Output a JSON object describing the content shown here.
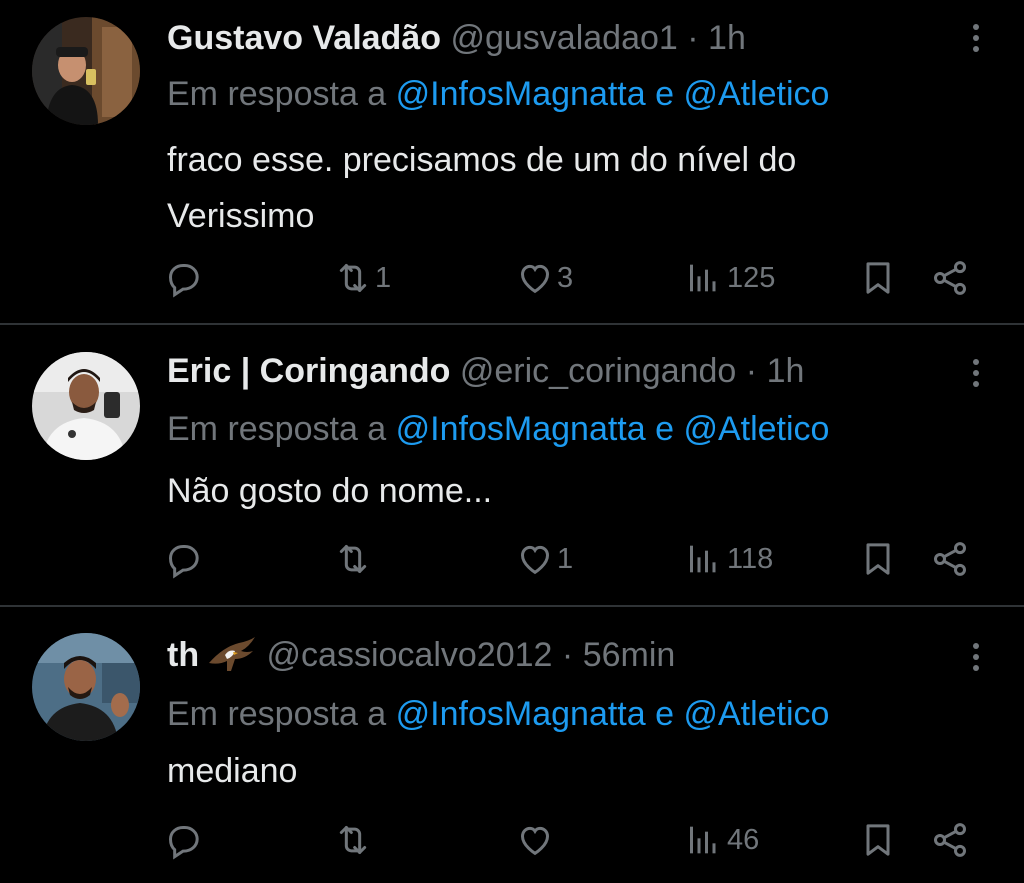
{
  "tweets": [
    {
      "name": "Gustavo Valadão",
      "handle": "@gusvaladao1",
      "time": "1h",
      "reply_label": "Em resposta a",
      "reply_mentions": "@InfosMagnatta e @Atletico",
      "text_line1": "fraco esse. precisamos de um do nível do",
      "text_line2": "Verissimo",
      "replies": "",
      "retweets": "1",
      "likes": "3",
      "views": "125"
    },
    {
      "name": "Eric | Coringando",
      "handle": "@eric_coringando",
      "time": "1h",
      "reply_label": "Em resposta a",
      "reply_mentions": "@InfosMagnatta e @Atletico",
      "text_line1": "Não gosto do nome...",
      "text_line2": "",
      "replies": "",
      "retweets": "",
      "likes": "1",
      "views": "118"
    },
    {
      "name": "th",
      "handle": "@cassiocalvo2012",
      "time": "56min",
      "reply_label": "Em resposta a",
      "reply_mentions": "@InfosMagnatta e @Atletico",
      "text_line1": "mediano",
      "text_line2": "",
      "replies": "",
      "retweets": "",
      "likes": "",
      "views": "46",
      "name_emoji": "eagle-icon"
    }
  ],
  "separator": "·",
  "colors": {
    "background": "#000000",
    "text": "#e7e9ea",
    "muted": "#71767b",
    "link": "#1d9bf0",
    "divider": "#2f3336"
  },
  "icons": [
    "reply-icon",
    "retweet-icon",
    "like-icon",
    "views-icon",
    "bookmark-icon",
    "share-icon",
    "more-icon"
  ]
}
